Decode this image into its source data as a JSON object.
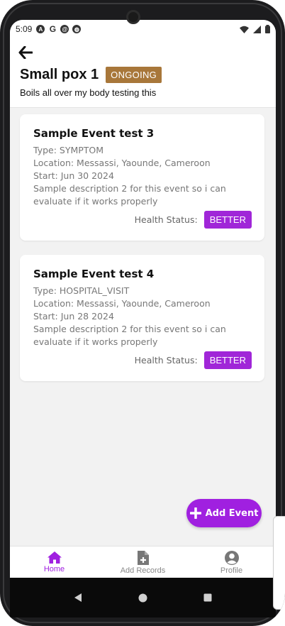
{
  "status_bar": {
    "time": "5:09"
  },
  "header": {
    "title": "Small pox 1",
    "status": "ONGOING",
    "subtitle": "Boils all over my body testing this"
  },
  "events": [
    {
      "title": "Sample Event test 3",
      "type": "Type: SYMPTOM",
      "location": "Location: Messassi, Yaounde, Cameroon",
      "start": "Start: Jun 30 2024",
      "description": "Sample description 2 for this event so i can evaluate if it works properly",
      "health_label": "Health Status:",
      "health_status": "BETTER"
    },
    {
      "title": "Sample Event test 4",
      "type": "Type: HOSPITAL_VISIT",
      "location": "Location: Messassi, Yaounde, Cameroon",
      "start": "Start: Jun 28 2024",
      "description": "Sample description 2 for this event so i can evaluate if it works properly",
      "health_label": "Health Status:",
      "health_status": "BETTER"
    }
  ],
  "fab": {
    "label": "Add Event"
  },
  "bottom_nav": {
    "home": "Home",
    "add_records": "Add Records",
    "profile": "Profile"
  },
  "colors": {
    "accent": "#a020e0",
    "badge": "#a8773a"
  }
}
